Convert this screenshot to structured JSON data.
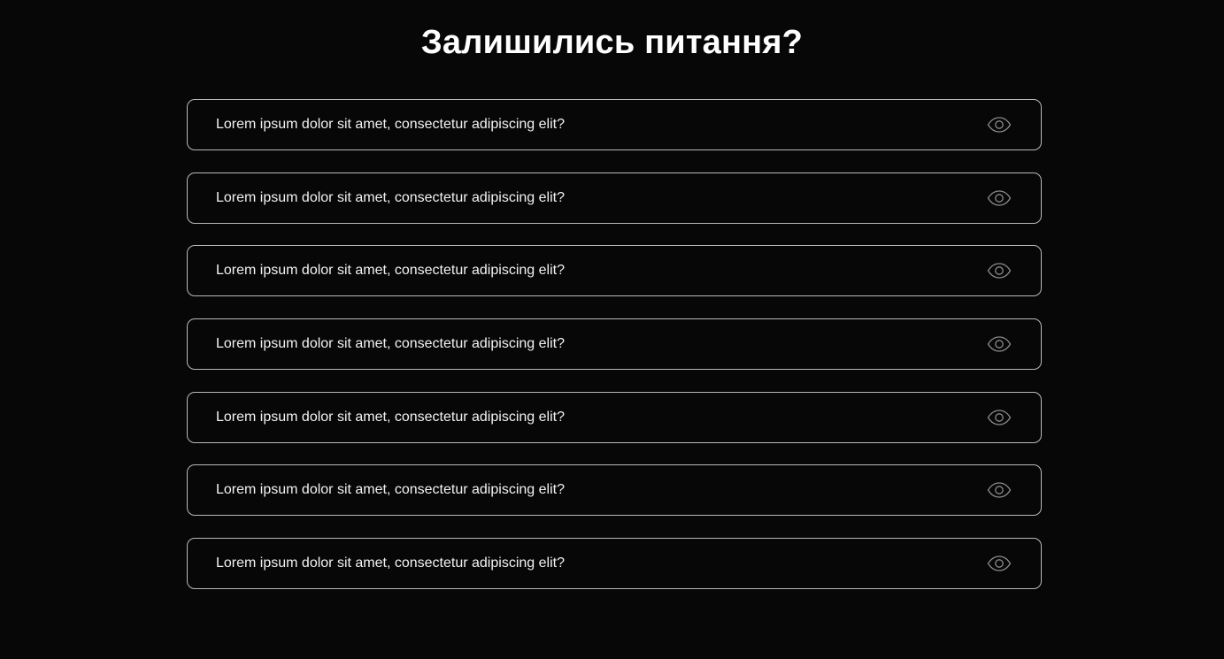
{
  "faq": {
    "title": "Залишились питання?",
    "items": [
      {
        "question": "Lorem ipsum dolor sit amet, consectetur adipiscing elit?",
        "icon": "eye-icon"
      },
      {
        "question": "Lorem ipsum dolor sit amet, consectetur adipiscing elit?",
        "icon": "eye-icon"
      },
      {
        "question": "Lorem ipsum dolor sit amet, consectetur adipiscing elit?",
        "icon": "eye-icon"
      },
      {
        "question": "Lorem ipsum dolor sit amet, consectetur adipiscing elit?",
        "icon": "eye-icon"
      },
      {
        "question": "Lorem ipsum dolor sit amet, consectetur adipiscing elit?",
        "icon": "eye-icon"
      },
      {
        "question": "Lorem ipsum dolor sit amet, consectetur adipiscing elit?",
        "icon": "eye-icon"
      },
      {
        "question": "Lorem ipsum dolor sit amet, consectetur adipiscing elit?",
        "icon": "eye-icon"
      }
    ]
  },
  "colors": {
    "background": "#070707",
    "text": "#ffffff",
    "border": "#b9b9b9",
    "icon": "#8a8a8a"
  }
}
